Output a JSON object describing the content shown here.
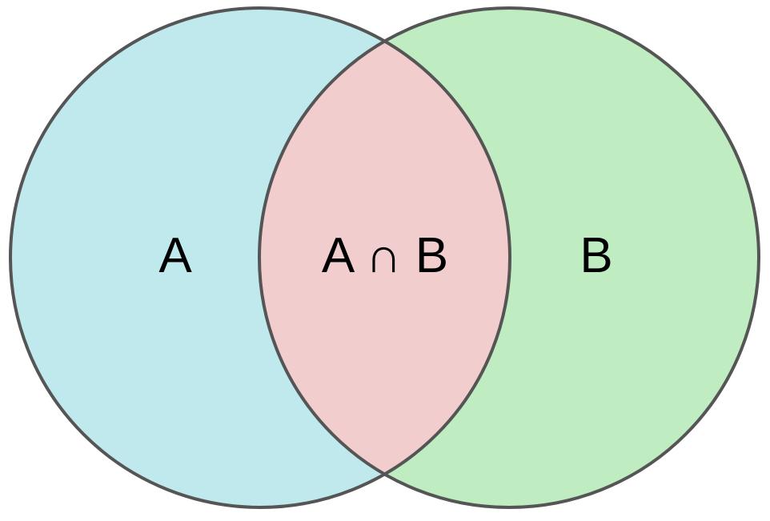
{
  "diagram": {
    "sets": [
      {
        "id": "set-a",
        "label": "A",
        "fill": "#bfe9ed"
      },
      {
        "id": "set-b",
        "label": "B",
        "fill": "#bfedc1"
      }
    ],
    "intersection": {
      "label": "A ∩ B",
      "fill": "#f2cdcd"
    },
    "outline_color": "#555555",
    "background": "#ffffff"
  }
}
